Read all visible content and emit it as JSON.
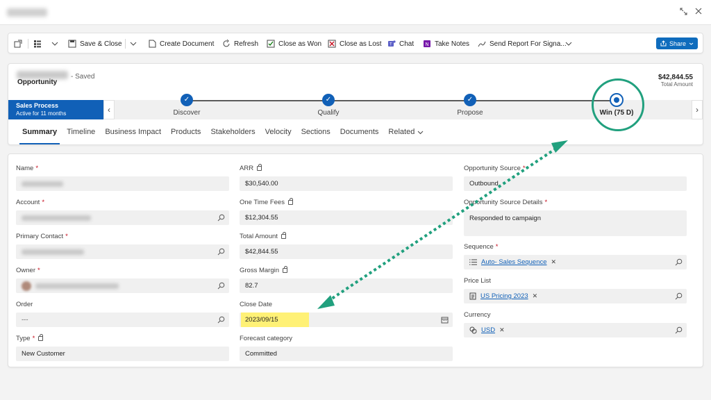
{
  "window": {
    "expand_icon": "expand-icon",
    "close_icon": "close-icon"
  },
  "toolbar": {
    "save_close": "Save & Close",
    "create_document": "Create Document",
    "refresh": "Refresh",
    "close_won": "Close as Won",
    "close_lost": "Close as Lost",
    "chat": "Chat",
    "take_notes": "Take Notes",
    "send_report": "Send Report For Signa...",
    "share": "Share"
  },
  "header": {
    "saved": "- Saved",
    "entity": "Opportunity",
    "total_amount": "$42,844.55",
    "total_amount_label": "Total Amount"
  },
  "process": {
    "name": "Sales Process",
    "status": "Active for 11 months",
    "stages": [
      {
        "label": "Discover",
        "state": "complete"
      },
      {
        "label": "Qualify",
        "state": "complete"
      },
      {
        "label": "Propose",
        "state": "complete"
      },
      {
        "label": "Win  (75 D)",
        "state": "active"
      }
    ]
  },
  "tabs": [
    "Summary",
    "Timeline",
    "Business Impact",
    "Products",
    "Stakeholders",
    "Velocity",
    "Sections",
    "Documents",
    "Related"
  ],
  "fields": {
    "name": {
      "label": "Name"
    },
    "account": {
      "label": "Account"
    },
    "primary_contact": {
      "label": "Primary Contact"
    },
    "owner": {
      "label": "Owner"
    },
    "order": {
      "label": "Order",
      "value": "---"
    },
    "type": {
      "label": "Type",
      "value": "New Customer"
    },
    "arr": {
      "label": "ARR",
      "value": "$30,540.00"
    },
    "one_time_fees": {
      "label": "One Time Fees",
      "value": "$12,304.55"
    },
    "total_amount": {
      "label": "Total Amount",
      "value": "$42,844.55"
    },
    "gross_margin": {
      "label": "Gross Margin",
      "value": "82.7"
    },
    "close_date": {
      "label": "Close Date",
      "value": "2023/09/15"
    },
    "forecast_category": {
      "label": "Forecast category",
      "value": "Committed"
    },
    "opportunity_source": {
      "label": "Opportunity Source",
      "value": "Outbound"
    },
    "opportunity_source_details": {
      "label": "Opportunity Source Details",
      "value": "Responded to campaign"
    },
    "sequence": {
      "label": "Sequence",
      "value": "Auto- Sales Sequence"
    },
    "price_list": {
      "label": "Price List",
      "value": "US Pricing 2023"
    },
    "currency": {
      "label": "Currency",
      "value": "USD"
    }
  },
  "colors": {
    "brand": "#1160b7",
    "annotation": "#21a07e",
    "highlight": "#fff176"
  }
}
